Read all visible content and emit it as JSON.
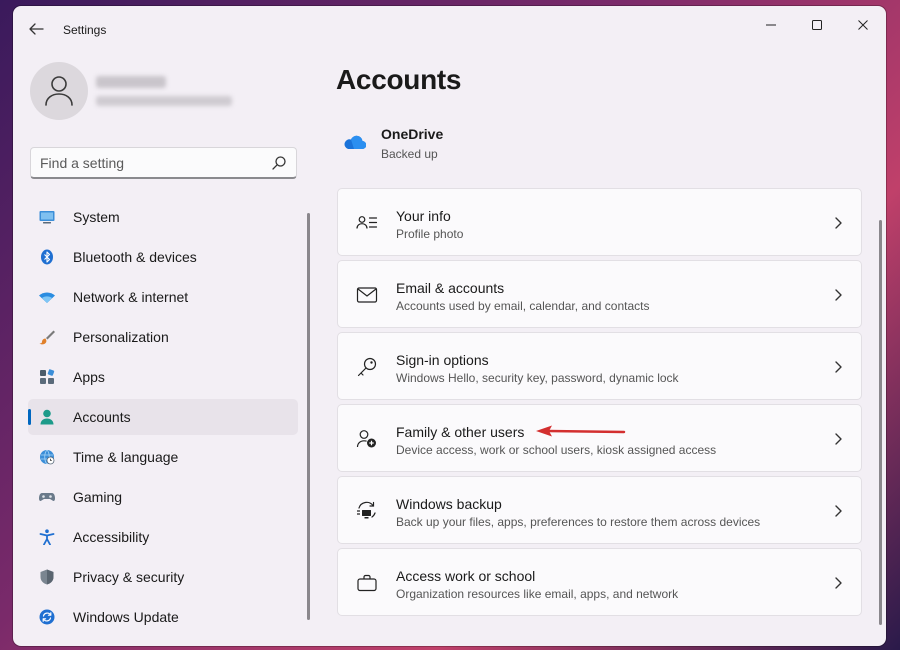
{
  "app": {
    "title": "Settings"
  },
  "profile": {
    "name": "Kevin Abl",
    "email": "kevinabl@gmail.com"
  },
  "search": {
    "placeholder": "Find a setting"
  },
  "sidebar": {
    "items": [
      {
        "label": "System",
        "icon": "monitor-icon",
        "active": false
      },
      {
        "label": "Bluetooth & devices",
        "icon": "bluetooth-icon",
        "active": false
      },
      {
        "label": "Network & internet",
        "icon": "wifi-icon",
        "active": false
      },
      {
        "label": "Personalization",
        "icon": "paintbrush-icon",
        "active": false
      },
      {
        "label": "Apps",
        "icon": "apps-icon",
        "active": false
      },
      {
        "label": "Accounts",
        "icon": "person-icon",
        "active": true
      },
      {
        "label": "Time & language",
        "icon": "globe-clock-icon",
        "active": false
      },
      {
        "label": "Gaming",
        "icon": "gamepad-icon",
        "active": false
      },
      {
        "label": "Accessibility",
        "icon": "accessibility-icon",
        "active": false
      },
      {
        "label": "Privacy & security",
        "icon": "shield-icon",
        "active": false
      },
      {
        "label": "Windows Update",
        "icon": "update-icon",
        "active": false
      }
    ]
  },
  "main": {
    "title": "Accounts",
    "onedrive": {
      "title": "OneDrive",
      "status": "Backed up"
    },
    "cards": [
      {
        "title": "Your info",
        "subtitle": "Profile photo",
        "icon": "contact-card-icon"
      },
      {
        "title": "Email & accounts",
        "subtitle": "Accounts used by email, calendar, and contacts",
        "icon": "mail-icon"
      },
      {
        "title": "Sign-in options",
        "subtitle": "Windows Hello, security key, password, dynamic lock",
        "icon": "key-icon"
      },
      {
        "title": "Family & other users",
        "subtitle": "Device access, work or school users, kiosk assigned access",
        "icon": "person-add-icon"
      },
      {
        "title": "Windows backup",
        "subtitle": "Back up your files, apps, preferences to restore them across devices",
        "icon": "backup-icon"
      },
      {
        "title": "Access work or school",
        "subtitle": "Organization resources like email, apps, and network",
        "icon": "briefcase-icon"
      }
    ]
  },
  "colors": {
    "accent": "#0067c0",
    "annotation": "#d32f2f"
  }
}
